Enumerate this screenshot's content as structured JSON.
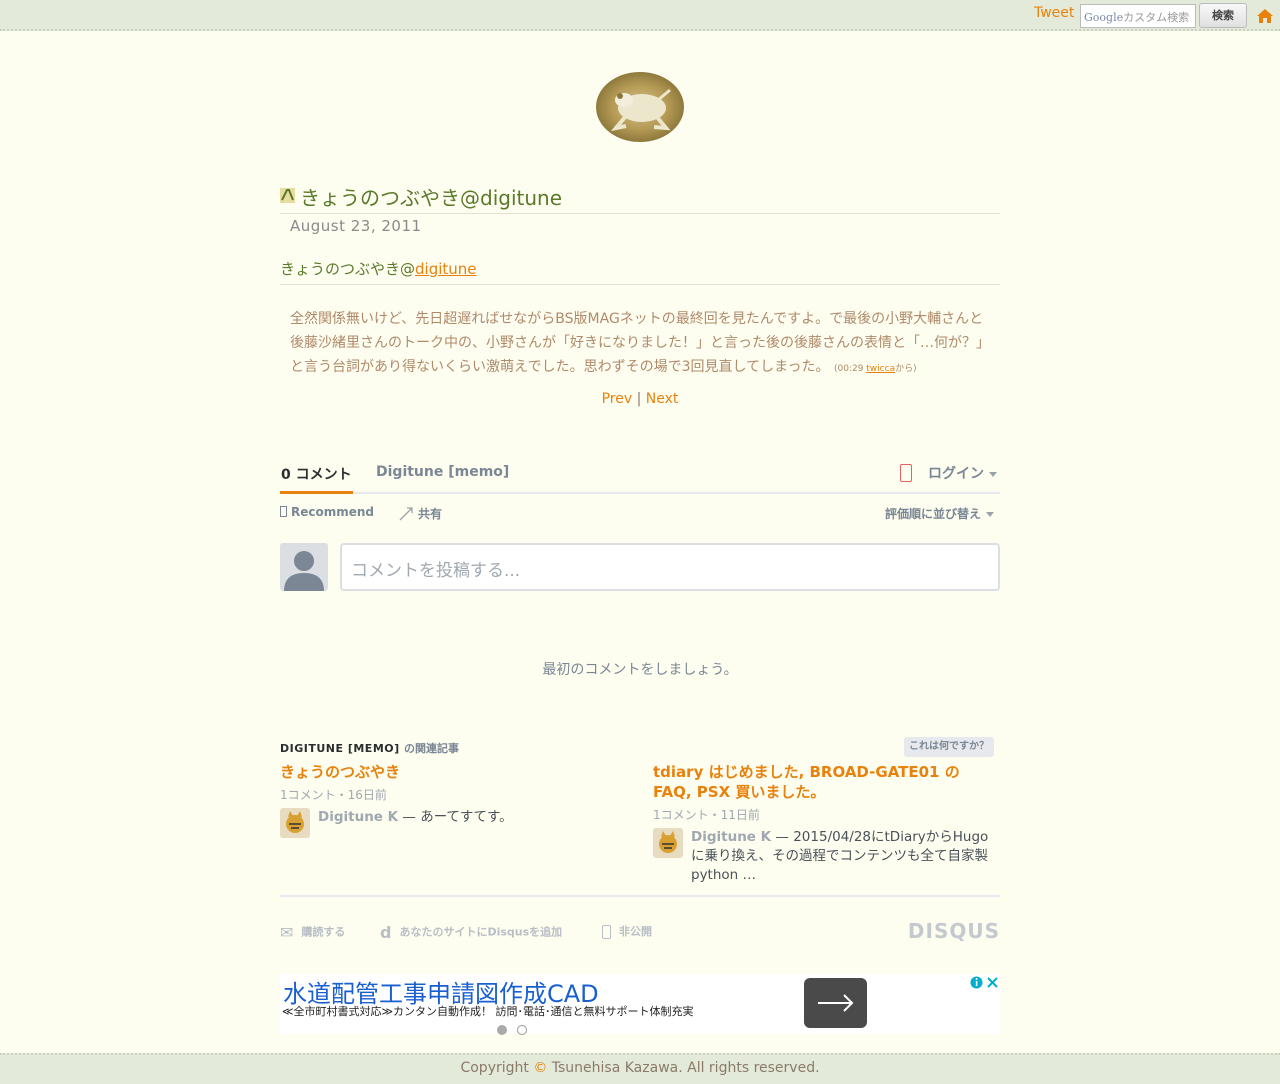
{
  "topbar": {
    "tweet": "Tweet",
    "search_placeholder_brand": "Google",
    "search_placeholder": "カスタム検索",
    "search_button": "検索"
  },
  "article": {
    "title": "きょうのつぶやき@digitune",
    "date": "August 23, 2011",
    "subtitle_prefix": "きょうのつぶやき@",
    "subtitle_link": "digitune",
    "body": "全然関係無いけど、先日超遅ればせながらBS版MAGネットの最終回を見たんですよ。で最後の小野大輔さんと後藤沙緒里さんのトーク中の、小野さんが「好きになりました！」と言った後の後藤さんの表情と「…何が？」と言う台詞があり得ないくらい激萌えでした。思わずその場で3回見直してしまった。",
    "meta_prefix": "(00:29 ",
    "meta_link": "twicca",
    "meta_suffix": "から)",
    "prev": "Prev",
    "sep": "|",
    "next": "Next"
  },
  "disqus": {
    "tab_comments": "0 コメント",
    "tab_site": "Digitune [memo]",
    "login": "ログイン",
    "recommend": "Recommend",
    "share": "共有",
    "sort": "評価順に並び替え",
    "comment_placeholder": "コメントを投稿する...",
    "first_comment": "最初のコメントをしましょう。",
    "related_site": "DIGITUNE [MEMO]",
    "related_label": "の関連記事",
    "what_is_this": "これは何ですか？",
    "related": [
      {
        "title": "きょうのつぶやき",
        "meta": "1コメント・16日前",
        "author": "Digitune K",
        "excerpt": " — あーてすてす。"
      },
      {
        "title": "tdiary はじめました, BROAD-GATE01 の FAQ, PSX 買いました。",
        "meta": "1コメント・11日前",
        "author": "Digitune K",
        "excerpt": " — 2015/04/28にtDiaryからHugoに乗り換え、その過程でコンテンツも全て自家製python …"
      }
    ],
    "footer_subscribe": "購読する",
    "footer_add": "あなたのサイトにDisqusを追加",
    "footer_privacy": "非公開",
    "brand": "DISQUS"
  },
  "ad": {
    "title": "水道配管工事申請図作成CAD",
    "description": "≪全市町村書式対応≫カンタン自動作成！ 訪問･電話･通信と無料サポート体制充実"
  },
  "footer": {
    "prefix": "Copyright ",
    "symbol": "©",
    "text": " Tsunehisa Kazawa. All rights reserved."
  },
  "colors": {
    "accent": "#e8820c",
    "title_green": "#5a7a2a",
    "bar_bg": "#e4ead9",
    "page_bg": "#fdfdf0"
  }
}
